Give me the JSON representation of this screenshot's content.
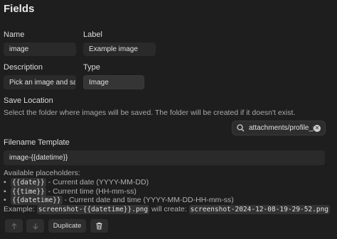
{
  "heading": "Fields",
  "name": {
    "label": "Name",
    "value": "image"
  },
  "field_label": {
    "label": "Label",
    "value": "Example image"
  },
  "description": {
    "label": "Description",
    "value": "Pick an image and save"
  },
  "type": {
    "label": "Type",
    "value": "Image"
  },
  "save_location": {
    "label": "Save Location",
    "help": "Select the folder where images will be saved. The folder will be created if it doesn't exist.",
    "value": "attachments/profile_pic"
  },
  "filename_template": {
    "label": "Filename Template",
    "value": "image-{{datetime}}"
  },
  "placeholders": {
    "heading": "Available placeholders:",
    "items": [
      {
        "code": "{{date}}",
        "text": " - Current date (YYYY-MM-DD)"
      },
      {
        "code": "{{time}}",
        "text": " - Current time (HH-mm-ss)"
      },
      {
        "code": "{{datetime}}",
        "text": " - Current date and time (YYYY-MM-DD-HH-mm-ss)"
      }
    ],
    "example_prefix": "Example: ",
    "example_code": "screenshot-{{datetime}}.png",
    "example_mid": " will create: ",
    "example_result": "screenshot-2024-12-08-19-29-52.png"
  },
  "buttons": {
    "duplicate": "Duplicate"
  },
  "icons": {
    "search": "search-icon",
    "clear": "clear-icon",
    "up": "arrow-up-icon",
    "down": "arrow-down-icon",
    "delete": "trash-icon"
  }
}
